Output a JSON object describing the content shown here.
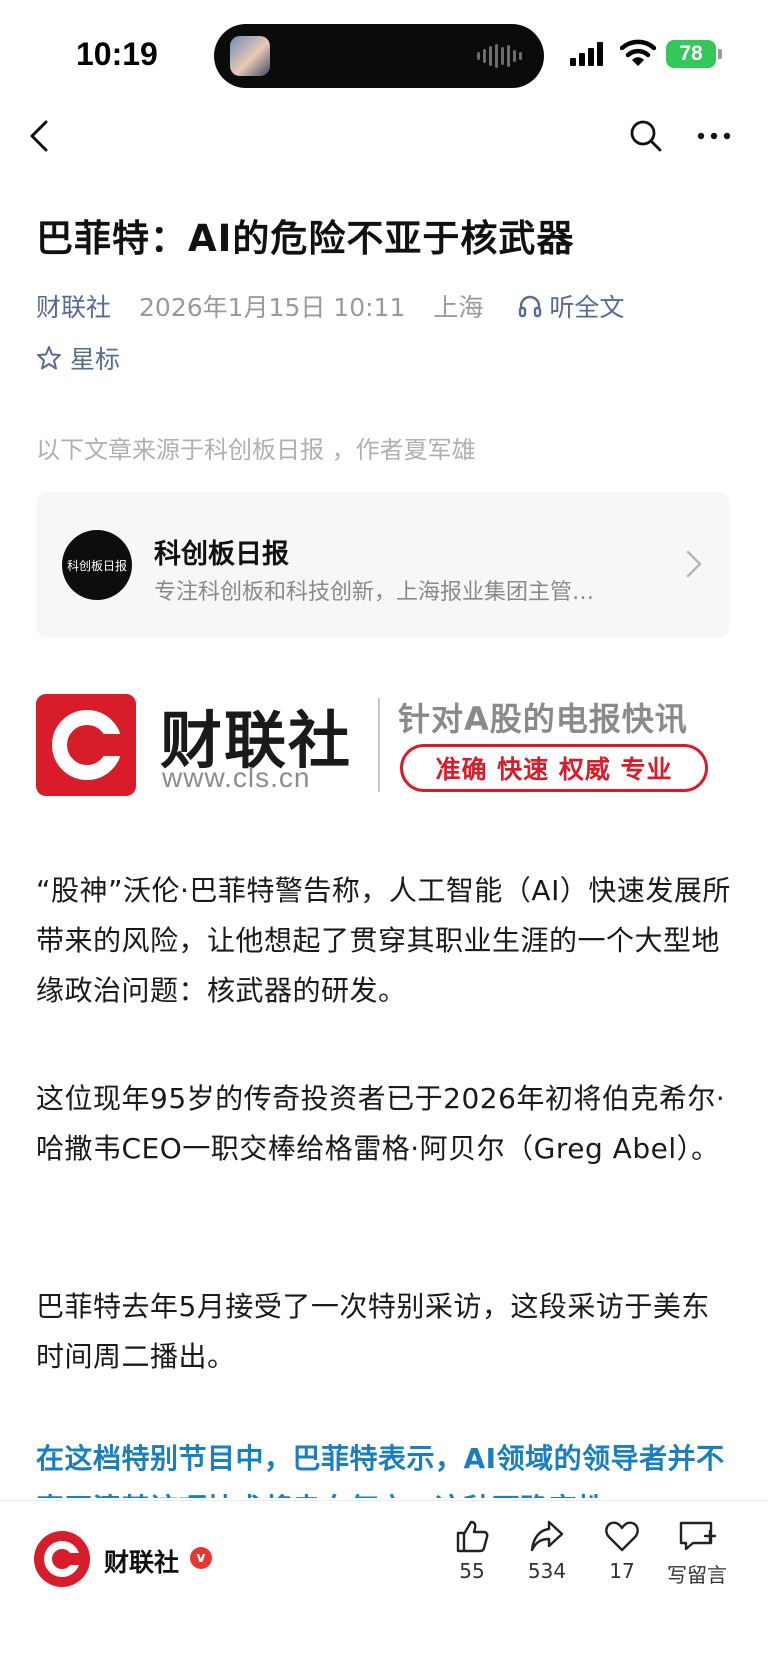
{
  "status_bar": {
    "time": "10:19",
    "battery": "78"
  },
  "article": {
    "title": "巴菲特：AI的危险不亚于核武器",
    "source": "财联社",
    "datetime": "2026年1月15日 10:11",
    "location": "上海",
    "listen_label": "听全文",
    "star_label": "星标",
    "source_note": "以下文章来源于科创板日报 ，作者夏军雄"
  },
  "account_card": {
    "logo_text": "科创板日报",
    "name": "科创板日报",
    "description": "专注科创板和科技创新，上海报业集团主管…"
  },
  "banner": {
    "brand": "财联社",
    "url": "www.cls.cn",
    "tagline": "针对A股的电报快讯",
    "pill": "准确 快速 权威 专业"
  },
  "body": {
    "p1": "“股神”沃伦·巴菲特警告称，人工智能（AI）快速发展所带来的风险，让他想起了贯穿其职业生涯的一个大型地缘政治问题：核武器的研发。",
    "p2": "这位现年95岁的传奇投资者已于2026年初将伯克希尔·哈撒韦CEO一职交棒给格雷格·阿贝尔（Greg Abel）。",
    "p3": "巴菲特去年5月接受了一次特别采访，这段采访于美东时间周二播出。",
    "p4": "在这档特别节目中，巴菲特表示，AI领域的领导者并不真正清楚该项技术将走向何方，这种不确定性"
  },
  "bottom_bar": {
    "account": "财联社",
    "verify": "v",
    "like_count": "55",
    "share_count": "534",
    "heart_count": "17",
    "comment_label": "写留言"
  },
  "icons": [
    "back-icon",
    "search-icon",
    "more-icon",
    "headphone-icon",
    "star-icon",
    "chevron-right-icon",
    "thumbs-up-icon",
    "share-icon",
    "heart-icon",
    "comment-icon"
  ]
}
